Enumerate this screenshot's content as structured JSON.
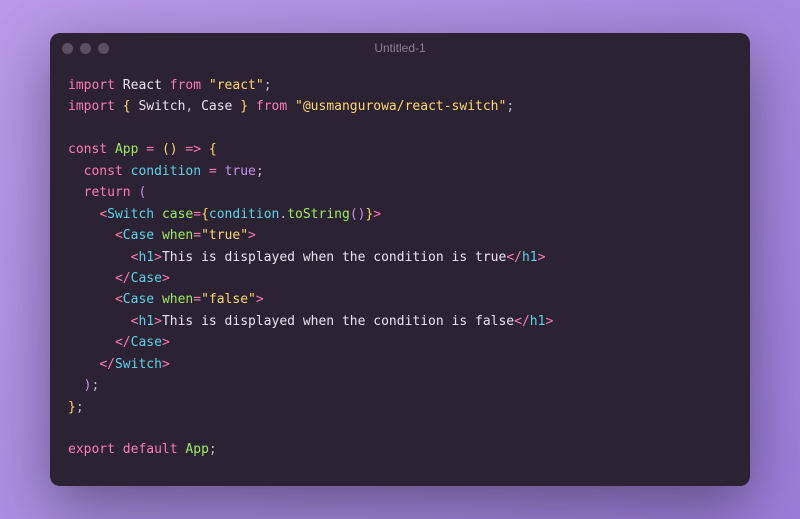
{
  "window": {
    "title": "Untitled-1"
  },
  "code": {
    "line1": {
      "kw1": "import",
      "name": "React",
      "kw2": "from",
      "str": "\"react\"",
      "semi": ";"
    },
    "line2": {
      "kw1": "import",
      "brace1": "{",
      "n1": "Switch",
      "comma": ",",
      "n2": "Case",
      "brace2": "}",
      "kw2": "from",
      "str": "\"@usmangurowa/react-switch\"",
      "semi": ";"
    },
    "line4": {
      "kw": "const",
      "name": "App",
      "eq": "=",
      "p1": "(",
      "p2": ")",
      "arrow": "=>",
      "brace": "{"
    },
    "line5": {
      "kw": "const",
      "name": "condition",
      "eq": "=",
      "val": "true",
      "semi": ";"
    },
    "line6": {
      "kw": "return",
      "p": "("
    },
    "line7": {
      "a1": "<",
      "tag": "Switch",
      "attr": "case",
      "eq": "=",
      "b1": "{",
      "obj": "condition",
      "dot": ".",
      "fn": "toString",
      "p1": "(",
      "p2": ")",
      "b2": "}",
      "a2": ">"
    },
    "line8": {
      "a1": "<",
      "tag": "Case",
      "attr": "when",
      "eq": "=",
      "str": "\"true\"",
      "a2": ">"
    },
    "line9": {
      "a1": "<",
      "tag": "h1",
      "a2": ">",
      "txt": "This is displayed when the condition is true",
      "a3": "</",
      "tag2": "h1",
      "a4": ">"
    },
    "line10": {
      "a1": "</",
      "tag": "Case",
      "a2": ">"
    },
    "line11": {
      "a1": "<",
      "tag": "Case",
      "attr": "when",
      "eq": "=",
      "str": "\"false\"",
      "a2": ">"
    },
    "line12": {
      "a1": "<",
      "tag": "h1",
      "a2": ">",
      "txt": "This is displayed when the condition is false",
      "a3": "</",
      "tag2": "h1",
      "a4": ">"
    },
    "line13": {
      "a1": "</",
      "tag": "Case",
      "a2": ">"
    },
    "line14": {
      "a1": "</",
      "tag": "Switch",
      "a2": ">"
    },
    "line15": {
      "p": ")",
      "semi": ";"
    },
    "line16": {
      "brace": "}",
      "semi": ";"
    },
    "line18": {
      "kw1": "export",
      "kw2": "default",
      "name": "App",
      "semi": ";"
    }
  }
}
